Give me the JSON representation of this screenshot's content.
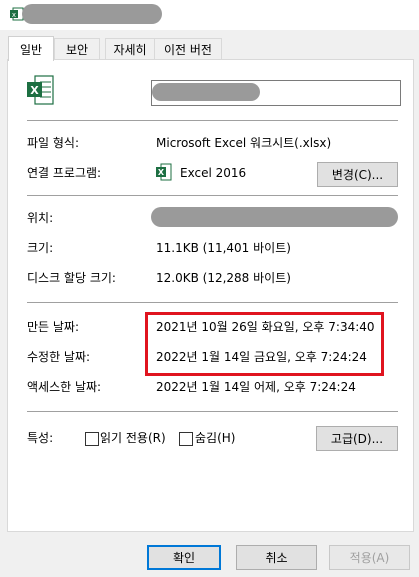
{
  "tabs": [
    {
      "label": "일반"
    },
    {
      "label": "보안"
    },
    {
      "label": "자세히"
    },
    {
      "label": "이전 버전"
    }
  ],
  "properties": {
    "file_type_label": "파일 형식:",
    "file_type_value": "Microsoft Excel 워크시트(.xlsx)",
    "open_with_label": "연결 프로그램:",
    "open_with_value": "Excel 2016",
    "change_button": "변경(C)...",
    "location_label": "위치:",
    "size_label": "크기:",
    "size_value": "11.1KB (11,401 바이트)",
    "size_on_disk_label": "디스크 할당 크기:",
    "size_on_disk_value": "12.0KB (12,288 바이트)",
    "created_label": "만든 날짜:",
    "created_value": "2021년 10월 26일 화요일, 오후 7:34:40",
    "modified_label": "수정한 날짜:",
    "modified_value": "2022년 1월 14일 금요일, 오후 7:24:24",
    "accessed_label": "액세스한 날짜:",
    "accessed_value": "2022년 1월 14일 어제, 오후 7:24:24",
    "attributes_label": "특성:",
    "readonly_label": "읽기 전용(R)",
    "hidden_label": "숨김(H)",
    "advanced_button": "고급(D)..."
  },
  "footer": {
    "ok": "확인",
    "cancel": "취소",
    "apply": "적용(A)"
  },
  "colors": {
    "excel_green": "#1d6f42",
    "highlight_red": "#e0141f",
    "accent": "#0078d7"
  },
  "icons": [
    "excel-file-icon",
    "excel-app-icon"
  ]
}
